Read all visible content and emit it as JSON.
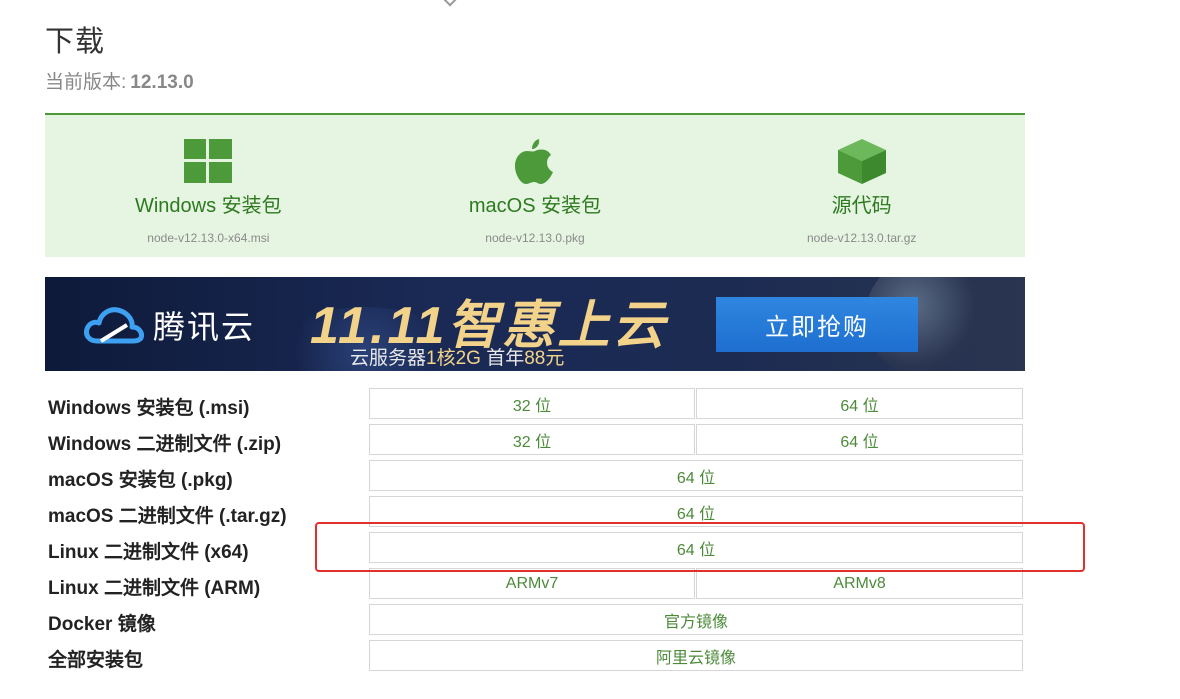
{
  "header": {
    "title": "下载",
    "version_label": "当前版本:",
    "version_value": "12.13.0"
  },
  "downloads": [
    {
      "label": "Windows 安装包",
      "file": "node-v12.13.0-x64.msi",
      "icon": "windows-icon"
    },
    {
      "label": "macOS 安装包",
      "file": "node-v12.13.0.pkg",
      "icon": "apple-icon"
    },
    {
      "label": "源代码",
      "file": "node-v12.13.0.tar.gz",
      "icon": "box-icon"
    }
  ],
  "banner": {
    "brand": "腾讯云",
    "promo_title": "11.11智惠上云",
    "promo_sub_pre": "云服务器",
    "promo_sub_hl1": "1核2G",
    "promo_sub_mid": " 首年",
    "promo_sub_hl2": "88元",
    "button": "立即抢购"
  },
  "table": {
    "rows": [
      {
        "label": "Windows 安装包 (.msi)",
        "cells": [
          "32 位",
          "64 位"
        ]
      },
      {
        "label": "Windows 二进制文件 (.zip)",
        "cells": [
          "32 位",
          "64 位"
        ]
      },
      {
        "label": "macOS 安装包 (.pkg)",
        "cells": [
          "64 位"
        ]
      },
      {
        "label": "macOS 二进制文件 (.tar.gz)",
        "cells": [
          "64 位"
        ]
      },
      {
        "label": "Linux 二进制文件 (x64)",
        "cells": [
          "64 位"
        ]
      },
      {
        "label": "Linux 二进制文件 (ARM)",
        "cells": [
          "ARMv7",
          "ARMv8"
        ]
      },
      {
        "label": "Docker 镜像",
        "cells": [
          "官方镜像"
        ]
      },
      {
        "label": "全部安装包",
        "cells": [
          "阿里云镜像"
        ]
      }
    ]
  },
  "colors": {
    "accent_green": "#4c9a3a",
    "panel_bg": "#e6f4e2",
    "highlight_red": "#e0302a",
    "button_blue": "#1e6fd0"
  }
}
